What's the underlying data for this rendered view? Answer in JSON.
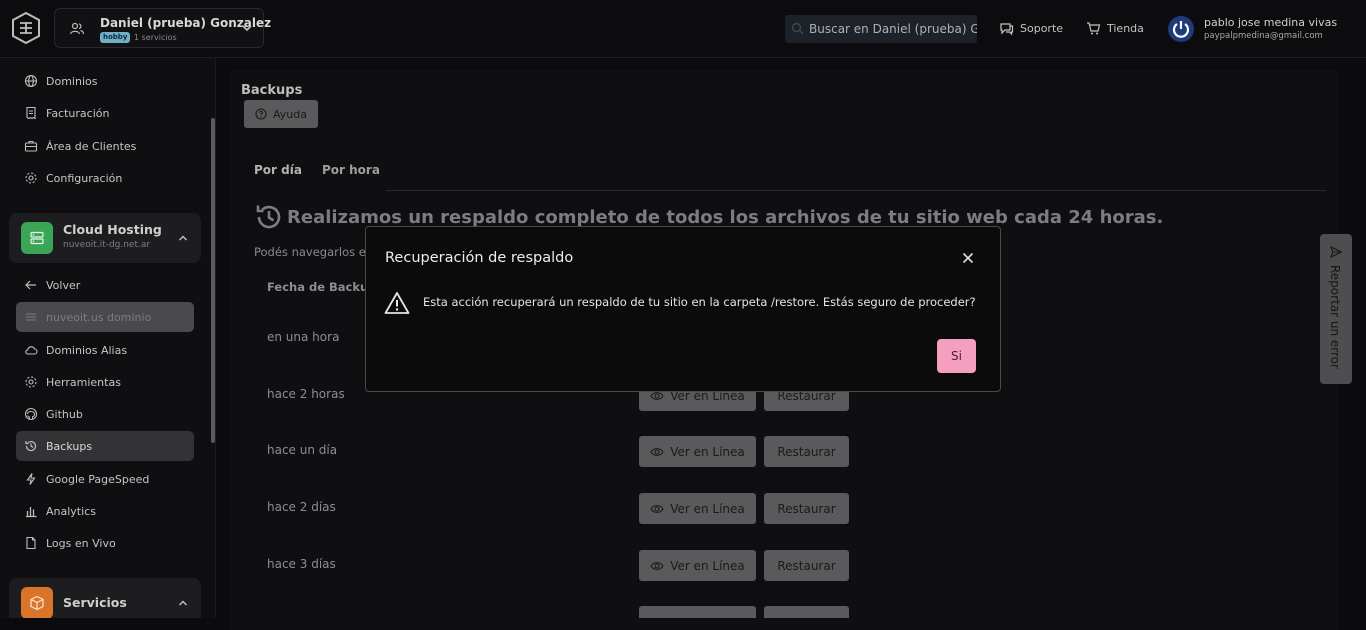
{
  "header": {
    "account_name": "Daniel (prueba) Gonzalez",
    "plan_badge": "hobby",
    "services_count": "1 servicios",
    "search_placeholder": "Buscar en Daniel (prueba) G",
    "support_label": "Soporte",
    "store_label": "Tienda",
    "user_name": "pablo jose medina vivas",
    "user_email": "paypalpmedina@gmail.com"
  },
  "sidebar": {
    "top_items": [
      {
        "label": "Dominios",
        "icon": "globe-icon"
      },
      {
        "label": "Facturación",
        "icon": "receipt-icon"
      },
      {
        "label": "Área de Clientes",
        "icon": "briefcase-icon"
      },
      {
        "label": "Configuración",
        "icon": "gear-icon"
      }
    ],
    "hosting_group": {
      "title": "Cloud Hosting",
      "subtitle": "nuveoit.it-dg.net.ar",
      "color": "#3aa655"
    },
    "back_label": "Volver",
    "domain_item": "nuveoit.us dominio",
    "sub_items": [
      {
        "label": "Dominios Alias",
        "icon": "cloud-icon"
      },
      {
        "label": "Herramientas",
        "icon": "gear-icon"
      },
      {
        "label": "Github",
        "icon": "github-icon"
      },
      {
        "label": "Backups",
        "icon": "history-icon",
        "active": true
      },
      {
        "label": "Google PageSpeed",
        "icon": "bolt-icon"
      },
      {
        "label": "Analytics",
        "icon": "bar-chart-icon"
      },
      {
        "label": "Logs en Vivo",
        "icon": "file-icon"
      }
    ],
    "services_group": {
      "title": "Servicios",
      "color": "#d9742a"
    }
  },
  "main": {
    "title": "Backups",
    "help_label": "Ayuda",
    "tabs": [
      "Por día",
      "Por hora"
    ],
    "message": "Realizamos un respaldo completo de todos los archivos de tu sitio web cada 24 horas.",
    "subtext": "Podés navegarlos e",
    "column_header": "Fecha de Backup",
    "rows": [
      {
        "label": "en una hora"
      },
      {
        "label": "hace 2 horas"
      },
      {
        "label": "hace un día"
      },
      {
        "label": "hace 2 días"
      },
      {
        "label": "hace 3 días"
      }
    ],
    "view_label": "Ver en Línea",
    "restore_label": "Restaurar"
  },
  "report_label": "Reportar un error",
  "modal": {
    "title": "Recuperación de respaldo",
    "message": "Esta acción recuperará un respaldo de tu sitio en la carpeta /restore. Estás seguro de proceder?",
    "confirm_label": "Si"
  }
}
